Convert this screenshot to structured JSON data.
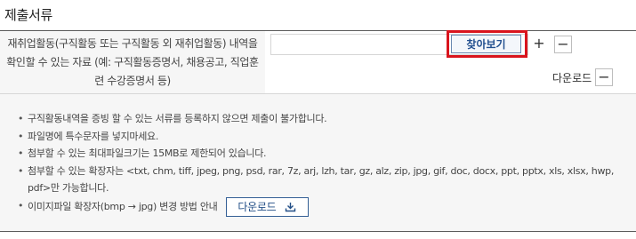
{
  "section": {
    "title": "제출서류"
  },
  "upload": {
    "label": "재취업활동(구직활동 또는 구직활동 외 재취업활동) 내역을 확인할 수 있는 자료 (예: 구직활동증명서, 채용공고, 직업훈련 수강증명서 등)",
    "file_value": "",
    "browse_label": "찾아보기",
    "add_label": "+",
    "remove_label": "−",
    "download_label": "다운로드",
    "remove_label2": "−"
  },
  "notices": [
    "구직활동내역을 증빙 할 수 있는 서류를 등록하지 않으면 제출이 불가합니다.",
    "파일명에 특수문자를 넣지마세요.",
    "첨부할 수 있는 최대파일크기는 15MB로 제한되어 있습니다.",
    "첨부할 수 있는 확장자는 <txt, chm, tiff, jpeg, png, psd, rar, 7z, arj, lzh, tar, gz, alz, zip, jpg, gif, doc, docx, ppt, pptx, xls, xlsx, hwp, pdf>만 가능합니다.",
    "이미지파일 확장자(bmp → jpg) 변경 방법 안내"
  ],
  "image_guide_download_label": "다운로드"
}
